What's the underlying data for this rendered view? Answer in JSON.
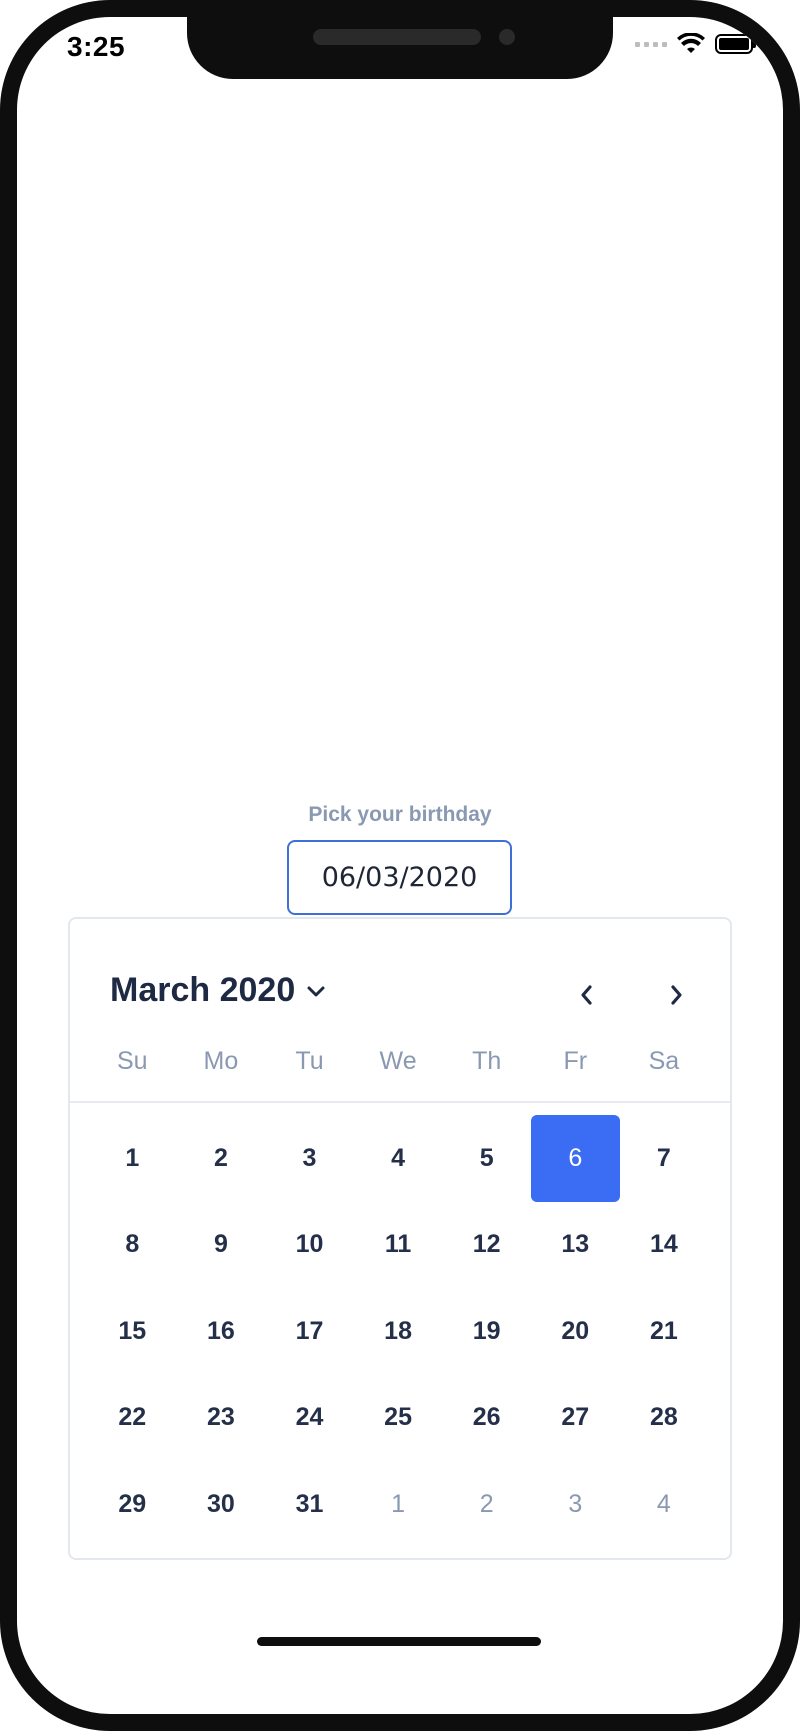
{
  "status_bar": {
    "time": "3:25",
    "icons": [
      "signal-icon",
      "wifi-icon",
      "battery-icon"
    ]
  },
  "form": {
    "label": "Pick your birthday",
    "date_value": "06/03/2020"
  },
  "calendar": {
    "month_title": "March 2020",
    "icons": {
      "month_dropdown": "chevron-down-icon",
      "prev": "chevron-left-icon",
      "next": "chevron-right-icon"
    },
    "weekdays": [
      "Su",
      "Mo",
      "Tu",
      "We",
      "Th",
      "Fr",
      "Sa"
    ],
    "days": [
      {
        "label": "1"
      },
      {
        "label": "2"
      },
      {
        "label": "3"
      },
      {
        "label": "4"
      },
      {
        "label": "5"
      },
      {
        "label": "6",
        "selected": true
      },
      {
        "label": "7"
      },
      {
        "label": "8"
      },
      {
        "label": "9"
      },
      {
        "label": "10"
      },
      {
        "label": "11"
      },
      {
        "label": "12"
      },
      {
        "label": "13"
      },
      {
        "label": "14"
      },
      {
        "label": "15"
      },
      {
        "label": "16"
      },
      {
        "label": "17"
      },
      {
        "label": "18"
      },
      {
        "label": "19"
      },
      {
        "label": "20"
      },
      {
        "label": "21"
      },
      {
        "label": "22"
      },
      {
        "label": "23"
      },
      {
        "label": "24"
      },
      {
        "label": "25"
      },
      {
        "label": "26"
      },
      {
        "label": "27"
      },
      {
        "label": "28"
      },
      {
        "label": "29"
      },
      {
        "label": "30"
      },
      {
        "label": "31"
      },
      {
        "label": "1",
        "outside": true
      },
      {
        "label": "2",
        "outside": true
      },
      {
        "label": "3",
        "outside": true
      },
      {
        "label": "4",
        "outside": true
      }
    ]
  },
  "colors": {
    "accent": "#3a6cf4",
    "input_border": "#3f6fd8",
    "muted_text": "#8a99b2",
    "day_text": "#24304a"
  }
}
